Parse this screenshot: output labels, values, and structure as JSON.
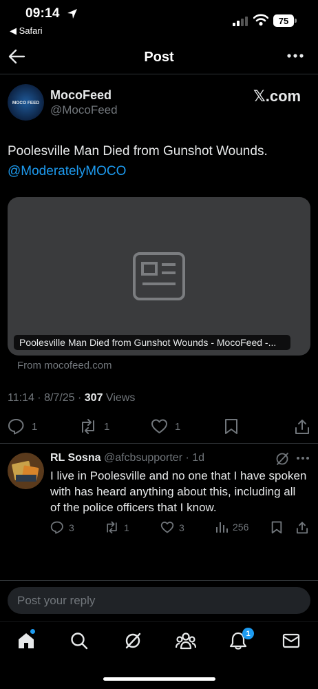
{
  "status_bar": {
    "time": "09:14",
    "back_app": "◀ Safari",
    "battery": "75"
  },
  "header": {
    "title": "Post"
  },
  "tweet": {
    "author_name": "MocoFeed",
    "author_handle": "@MocoFeed",
    "avatar_text": "MOCO FEED",
    "source_logo": "𝕏.com",
    "text": "Poolesville Man Died from Gunshot Wounds.",
    "mention": "@ModeratelyMOCO",
    "card": {
      "caption": "Poolesville Man Died from Gunshot Wounds - MocoFeed -...",
      "source": "From mocofeed.com"
    },
    "timestamp": "11:14 · 8/7/25 · ",
    "views_count": "307",
    "views_label": " Views",
    "actions": {
      "replies": "1",
      "reposts": "1",
      "likes": "1"
    }
  },
  "reply": {
    "name": "RL Sosna",
    "handle": "@afcbsupporter",
    "time": "1d",
    "text": "I live in Poolesville and no one that I have spoken with has heard anything about this, including all of the police officers that I know.",
    "actions": {
      "replies": "3",
      "reposts": "1",
      "likes": "3",
      "views": "256"
    }
  },
  "compose": {
    "placeholder": "Post your reply"
  },
  "tab_bar": {
    "notifications_badge": "1"
  },
  "colors": {
    "background": "#000000",
    "accent": "#1d9bf0",
    "text": "#e7e9ea",
    "muted": "#71767b",
    "divider": "#2f3336"
  }
}
